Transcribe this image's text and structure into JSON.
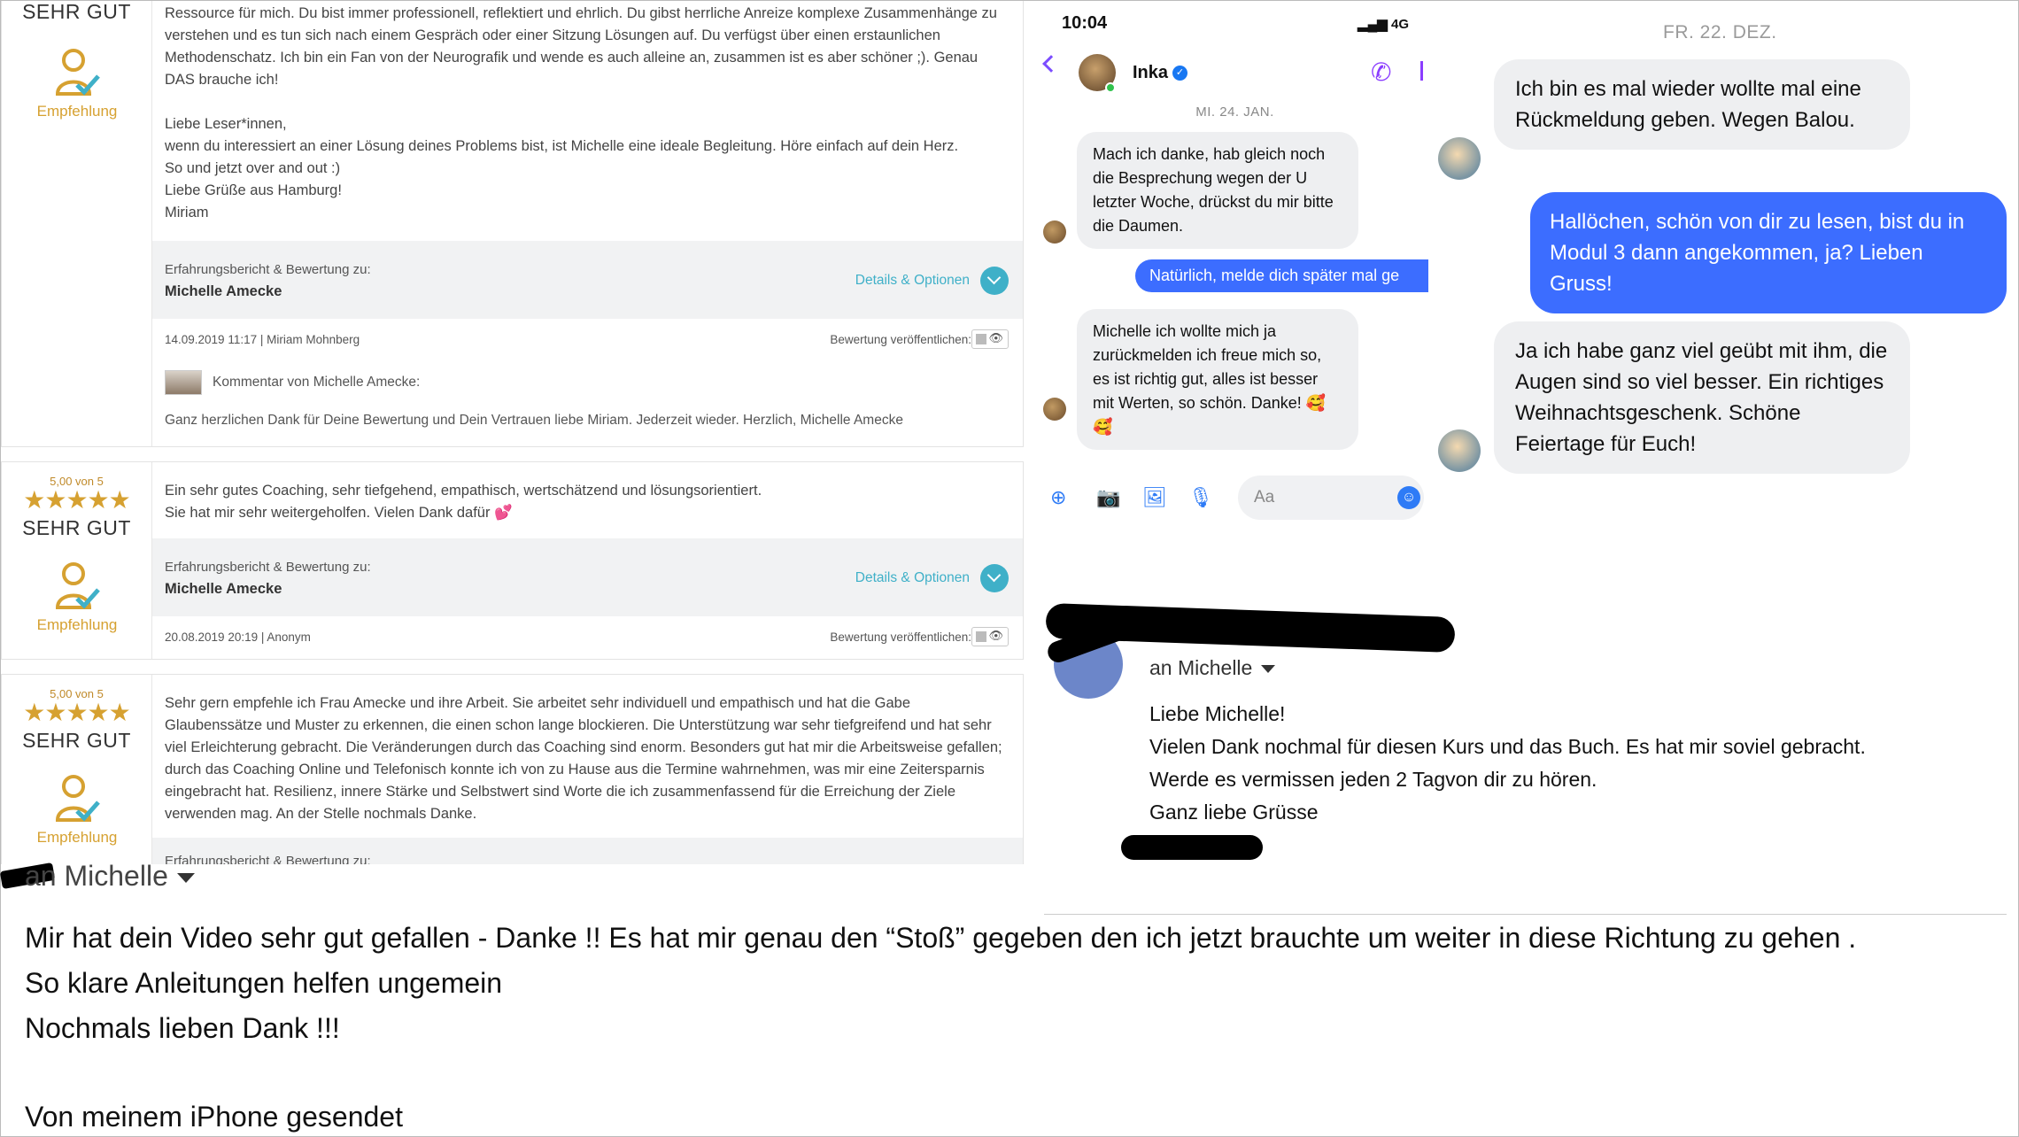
{
  "reviews": [
    {
      "grade": "SEHR GUT",
      "recommend_label": "Empfehlung",
      "text": "ich freue mich auf den weiteren Weg. Vielen Dank ausgesprochen. Du bist stets, also seit knapp 3 Jahren (!!), eine wichtige Ressource für mich. Du bist immer professionell, reflektiert und ehrlich. Du gibst herrliche Anreize komplexe Zusammenhänge zu verstehen und es tun sich nach einem Gespräch oder einer Sitzung Lösungen auf. Du verfügst über einen erstaunlichen Methodenschatz. Ich bin ein Fan von der Neurografik und wende es auch alleine an, zusammen ist es aber schöner ;). Genau DAS brauche ich!\n\nLiebe Leser*innen,\nwenn du interessiert an einer Lösung deines Problems bist, ist Michelle eine ideale Begleitung. Höre einfach auf dein Herz.\nSo und jetzt over and out :)\nLiebe Grüße aus Hamburg!\nMiriam",
      "bar_label": "Erfahrungsbericht & Bewertung zu:",
      "bar_name": "Michelle Amecke",
      "details_link": "Details & Optionen",
      "meta": "14.09.2019 11:17 | Miriam Mohnberg",
      "publish_label": "Bewertung veröffentlichen:",
      "comment_head": "Kommentar von Michelle Amecke:",
      "comment": "Ganz herzlichen Dank für Deine Bewertung und Dein Vertrauen liebe Miriam. Jederzeit wieder. Herzlich, Michelle Amecke"
    },
    {
      "score": "5,00 von 5",
      "stars": "★★★★★",
      "grade": "SEHR GUT",
      "recommend_label": "Empfehlung",
      "text": "Ein sehr gutes Coaching, sehr tiefgehend, empathisch, wertschätzend und lösungsorientiert.\nSie hat mir sehr weitergeholfen. Vielen Dank dafür 💕",
      "bar_label": "Erfahrungsbericht & Bewertung zu:",
      "bar_name": "Michelle Amecke",
      "details_link": "Details & Optionen",
      "meta": "20.08.2019 20:19 | Anonym",
      "publish_label": "Bewertung veröffentlichen:"
    },
    {
      "score": "5,00 von 5",
      "stars": "★★★★★",
      "grade": "SEHR GUT",
      "recommend_label": "Empfehlung",
      "text": "Sehr gern empfehle ich Frau Amecke und ihre Arbeit. Sie arbeitet sehr individuell und empathisch und hat die Gabe Glaubenssätze und Muster zu erkennen, die einen schon lange blockieren. Die Unterstützung war sehr tiefgreifend und hat sehr viel Erleichterung gebracht. Die Veränderungen durch das Coaching sind enorm. Besonders gut hat mir die Arbeitsweise gefallen; durch das Coaching Online und Telefonisch konnte ich von zu Hause aus die Termine wahrnehmen, was mir eine Zeitersparnis eingebracht hat. Resilienz, innere Stärke und Selbstwert sind Worte die ich zusammenfassend für die Erreichung der Ziele verwenden mag. An der Stelle nochmals Danke.",
      "bar_label": "Erfahrungsbericht & Bewertung zu:"
    }
  ],
  "phone": {
    "time": "10:04",
    "network": "4G",
    "contact": "Inka",
    "date": "MI. 24. JAN.",
    "messages": [
      "Mach ich danke, hab gleich noch die Besprechung wegen der U letzter Woche, drückst du mir bitte die Daumen.",
      "Natürlich, melde dich später mal ge",
      "Michelle ich wollte mich ja zurückmelden ich freue mich so, es ist richtig gut, alles ist besser mit Werten, so schön. Danke! 🥰 🥰"
    ],
    "input_placeholder": "Aa"
  },
  "right_chat": {
    "date": "FR. 22. DEZ.",
    "messages": [
      "Ich bin es mal wieder wollte mal eine Rückmeldung geben. Wegen Balou.",
      "Hallöchen, schön von dir zu lesen, bist du in Modul 3 dann angekommen, ja? Lieben Gruss!",
      "Ja ich habe ganz viel geübt mit ihm, die Augen sind so viel besser. Ein richtiges Weihnachtsgeschenk. Schöne Feiertage für Euch!"
    ]
  },
  "mail_one": {
    "to": "an Michelle",
    "lines": [
      "Liebe Michelle!",
      "Vielen Dank nochmal für diesen Kurs und das Buch. Es hat mir soviel gebracht.",
      "Werde es vermissen jeden 2 Tagvon dir zu hören.",
      "Ganz liebe Grüsse"
    ]
  },
  "mail_two": {
    "to": "an Michelle",
    "lines": [
      "Mir hat dein Video sehr gut gefallen - Danke !! Es hat mir genau den “Stoß” gegeben den ich jetzt brauchte um weiter in diese Richtung zu gehen .",
      "So klare Anleitungen helfen ungemein",
      "Nochmals lieben Dank !!!",
      "Von meinem iPhone gesendet"
    ]
  },
  "colors": {
    "accent_teal": "#3fb0c8",
    "star_gold": "#d6a131",
    "messenger_blue": "#3c6dff",
    "messenger_purple": "#8b3dff"
  }
}
